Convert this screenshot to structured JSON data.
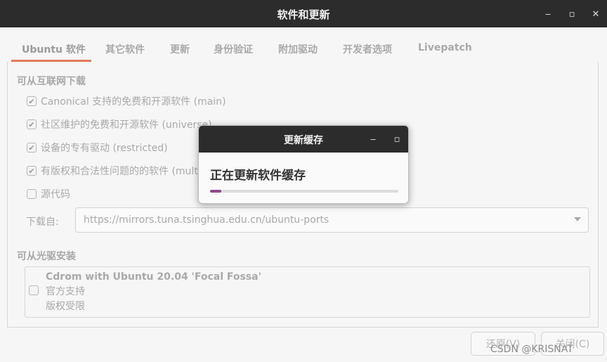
{
  "window": {
    "title": "软件和更新"
  },
  "tabs": [
    "Ubuntu 软件",
    "其它软件",
    "更新",
    "身份验证",
    "附加驱动",
    "开发者选项",
    "Livepatch"
  ],
  "downloadable": {
    "title": "可从互联网下载",
    "items": [
      {
        "label": "Canonical 支持的免费和开源软件 (main)",
        "checked": true
      },
      {
        "label": "社区维护的免费和开源软件 (universe)",
        "checked": true
      },
      {
        "label": "设备的专有驱动 (restricted)",
        "checked": true
      },
      {
        "label": "有版权和合法性问题的的软件 (multiverse)",
        "checked": true
      },
      {
        "label": "源代码",
        "checked": false
      }
    ],
    "download_from_label": "下载自:",
    "server": "https://mirrors.tuna.tsinghua.edu.cn/ubuntu-ports"
  },
  "cdrom": {
    "title": "可从光驱安装",
    "name": "Cdrom with Ubuntu 20.04 'Focal Fossa'",
    "line2": "官方支持",
    "line3": "版权受限"
  },
  "buttons": {
    "revert": "还原(V)",
    "close": "关闭(C)"
  },
  "watermark": "CSDN @KRISNAT",
  "dialog": {
    "title": "更新缓存",
    "heading": "正在更新软件缓存",
    "progress": 0.06
  },
  "icons": {
    "minimize": "minimize-icon",
    "maximize": "maximize-icon",
    "close": "close-icon",
    "checkmark": "check-icon",
    "dropdown": "chevron-down-icon"
  }
}
